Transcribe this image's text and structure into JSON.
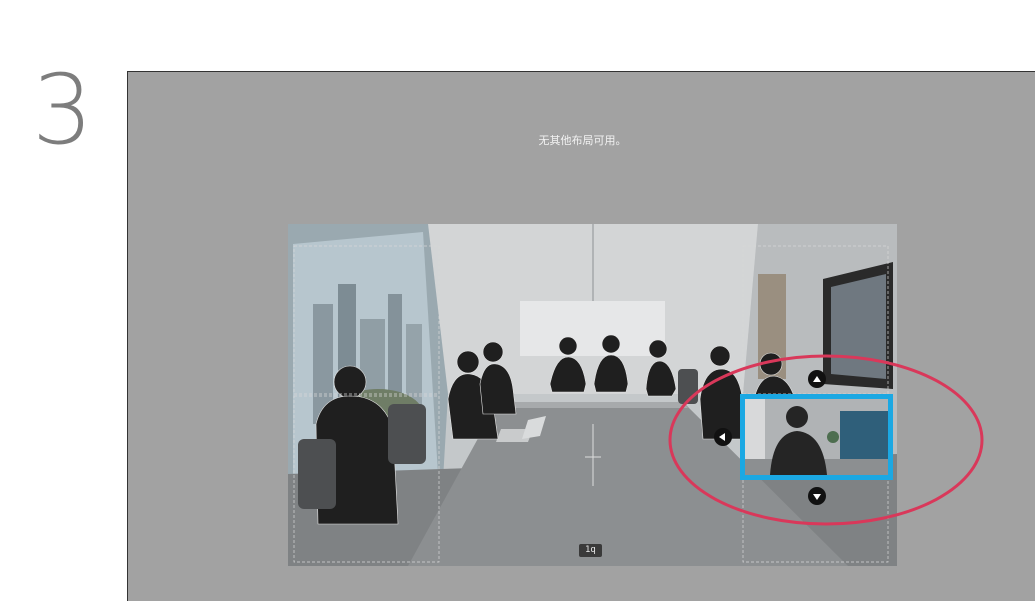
{
  "step": {
    "number": "3"
  },
  "screen": {
    "message": "无其他布局可用。",
    "participant_badge": "1q"
  },
  "colors": {
    "pip_border": "#1ba8e3",
    "highlight_ring": "#d9385a",
    "screen_bg": "#a2a2a2"
  },
  "icons": {
    "nav_up": "arrow-up-icon",
    "nav_down": "arrow-down-icon",
    "nav_left": "arrow-left-icon"
  }
}
